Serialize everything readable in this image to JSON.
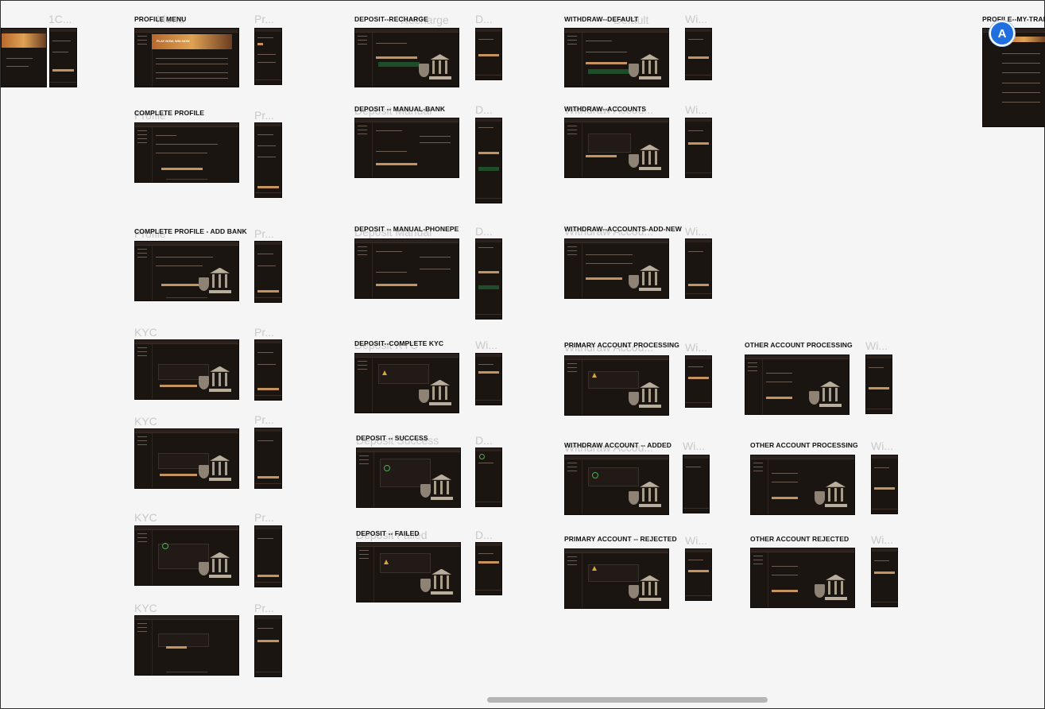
{
  "canvas": {
    "ghost_labels": [
      "1C...",
      "Menu",
      "Pr...",
      "Recharge",
      "D...",
      "Default",
      "Wi...",
      "Profile",
      "Pr...",
      "Deposit Manual",
      "D...",
      "Withdraw Accou...",
      "Wi...",
      "Profile",
      "Pr...",
      "Deposit Manual",
      "D...",
      "Withdraw Accou...",
      "Wi...",
      "KYC",
      "Pr...",
      "Deposit KYC",
      "Wi...",
      "Withdraw Accou...",
      "Wi...",
      "Wi...",
      "KYC",
      "Pr...",
      "Deposit Success",
      "D...",
      "Withdraw Accou...",
      "Wi...",
      "Wi...",
      "KYC",
      "Pr...",
      "Deposit Failed",
      "D...",
      "Wi...",
      "Wi...",
      "KYC",
      "Pr..."
    ],
    "overlay_labels": [
      "PROFILE MENU",
      "DEPOSIT--RECHARGE",
      "WITHDRAW--DEFAULT",
      "PROFILE--MY-TRADE",
      "COMPLETE PROFILE",
      "DEPOSIT -- MANUAL-BANK",
      "WITHDRAW--ACCOUNTS",
      "COMPLETE PROFILE - ADD BANK",
      "DEPOSIT -- MANUAL-PHONEPE",
      "WITHDRAW--ACCOUNTS-ADD-NEW",
      "DEPOSIT--COMPLETE KYC",
      "PRIMARY ACCOUNT PROCESSING",
      "OTHER ACCOUNT PROCESSING",
      "DEPOSIT -- SUCCESS",
      "WITHDRAW ACCOUNT -- ADDED",
      "OTHER ACCOUNT PROCESSING",
      "DEPOSIT -- FAILED",
      "PRIMARY ACCOUNT -- REJECTED",
      "OTHER ACCOUNT REJECTED"
    ],
    "banner_text": "PLAY NOW, WIN NOW"
  },
  "collaborator": {
    "initial": "A",
    "color": "#1f6fe0"
  },
  "theme": {
    "frame_bg": "#1b1512",
    "accent": "#c4935e",
    "canvas_bg": "#f5f5f5"
  }
}
